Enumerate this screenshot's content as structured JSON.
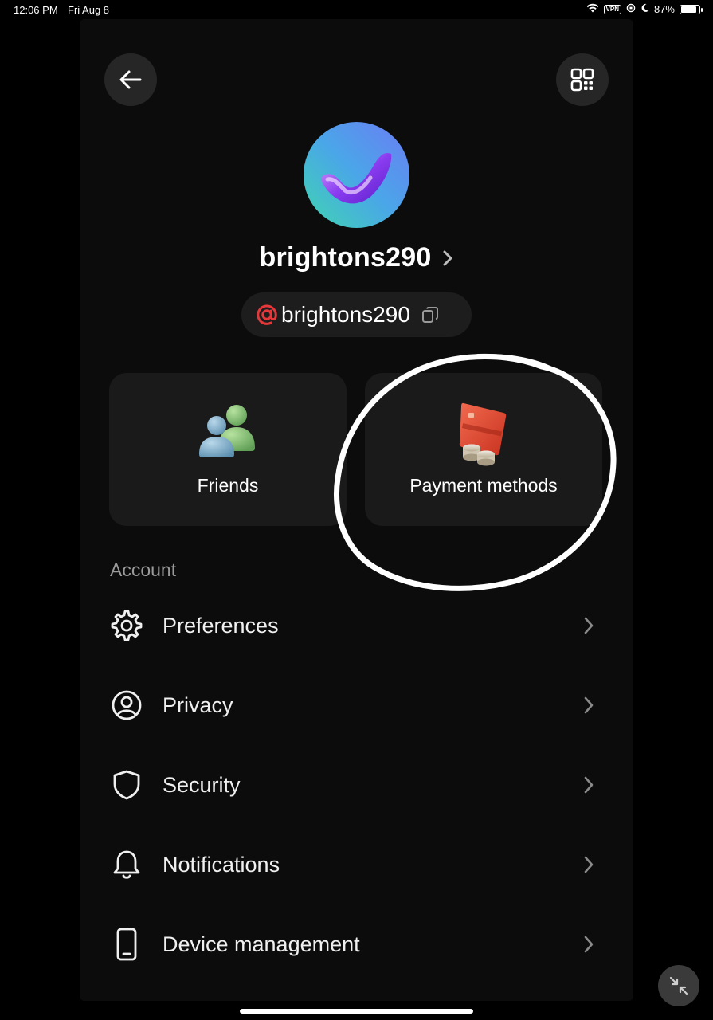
{
  "status_bar": {
    "time": "12:06 PM",
    "date": "Fri Aug 8",
    "vpn": "VPN",
    "battery": "87%",
    "battery_level": 0.87
  },
  "profile": {
    "username": "brightons290",
    "handle": "brightons290"
  },
  "cards": [
    {
      "label": "Friends",
      "icon": "friends-icon"
    },
    {
      "label": "Payment methods",
      "icon": "payment-card-icon"
    }
  ],
  "account": {
    "title": "Account",
    "items": [
      {
        "label": "Preferences",
        "icon": "gear-icon"
      },
      {
        "label": "Privacy",
        "icon": "user-circle-icon"
      },
      {
        "label": "Security",
        "icon": "shield-icon"
      },
      {
        "label": "Notifications",
        "icon": "bell-icon"
      },
      {
        "label": "Device management",
        "icon": "phone-icon"
      }
    ]
  },
  "colors": {
    "background": "#000000",
    "panel": "#0c0c0c",
    "card": "#1a1a1a",
    "accent_red": "#e5383b"
  }
}
